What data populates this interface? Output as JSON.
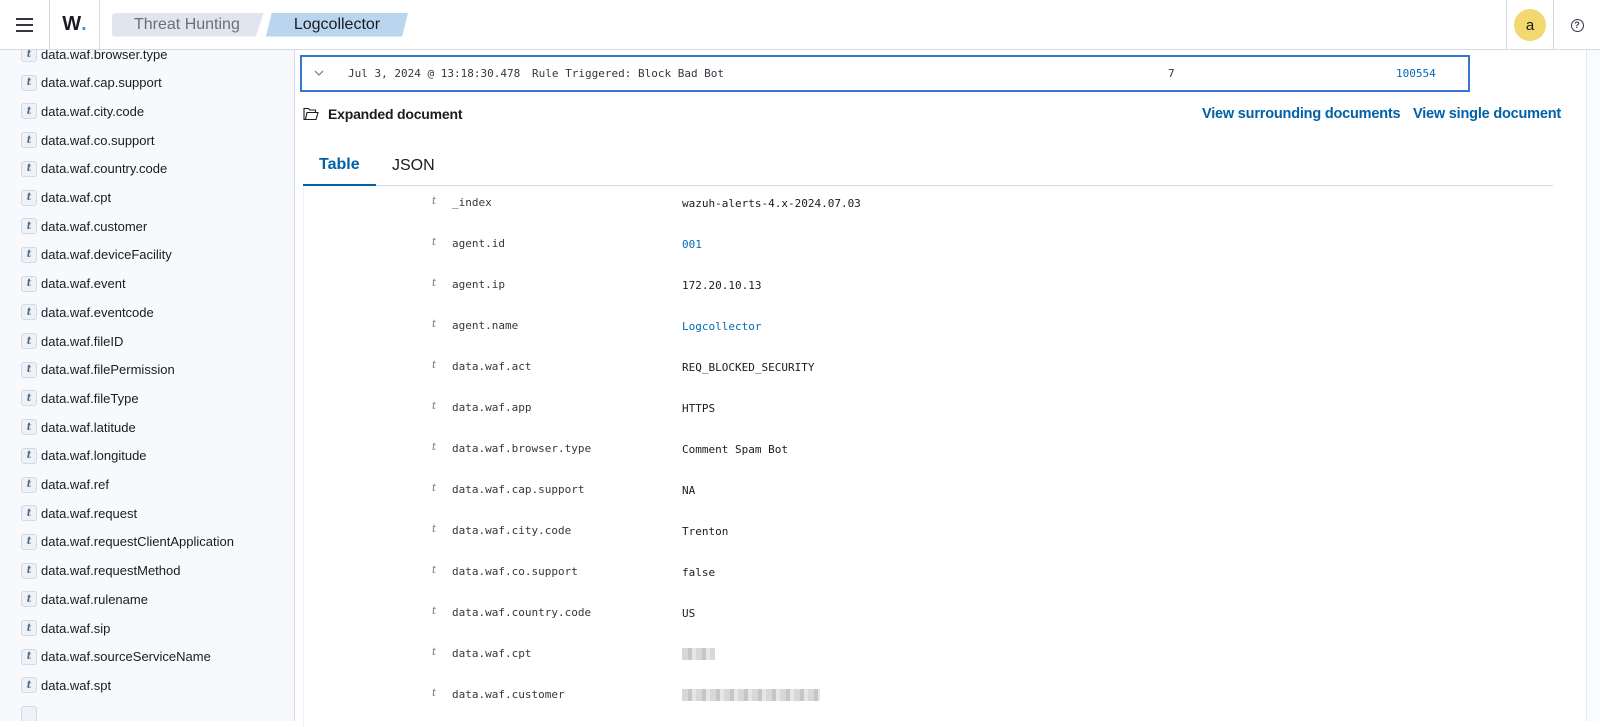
{
  "header": {
    "menu_icon": "hamburger-icon",
    "logo_text": "W",
    "logo_dot": ".",
    "breadcrumbs": [
      {
        "label": "Threat Hunting"
      },
      {
        "label": "Logcollector"
      }
    ],
    "avatar_initial": "a",
    "help_icon": "?"
  },
  "sidebar": {
    "field_type": "t",
    "items": [
      {
        "label": "data.waf.browser.type"
      },
      {
        "label": "data.waf.cap.support"
      },
      {
        "label": "data.waf.city.code"
      },
      {
        "label": "data.waf.co.support"
      },
      {
        "label": "data.waf.country.code"
      },
      {
        "label": "data.waf.cpt"
      },
      {
        "label": "data.waf.customer"
      },
      {
        "label": "data.waf.deviceFacility"
      },
      {
        "label": "data.waf.event"
      },
      {
        "label": "data.waf.eventcode"
      },
      {
        "label": "data.waf.fileID"
      },
      {
        "label": "data.waf.filePermission"
      },
      {
        "label": "data.waf.fileType"
      },
      {
        "label": "data.waf.latitude"
      },
      {
        "label": "data.waf.longitude"
      },
      {
        "label": "data.waf.ref"
      },
      {
        "label": "data.waf.request"
      },
      {
        "label": "data.waf.requestClientApplication"
      },
      {
        "label": "data.waf.requestMethod"
      },
      {
        "label": "data.waf.rulename"
      },
      {
        "label": "data.waf.sip"
      },
      {
        "label": "data.waf.sourceServiceName"
      },
      {
        "label": "data.waf.spt"
      }
    ]
  },
  "event_row": {
    "timestamp": "Jul 3, 2024 @ 13:18:30.478",
    "description": "Rule Triggered: Block Bad Bot",
    "rule_level": "7",
    "rule_id": "100554"
  },
  "expanded": {
    "title": "Expanded document",
    "view_surrounding": "View surrounding documents",
    "view_single": "View single document",
    "tabs": [
      {
        "label": "Table",
        "active": true
      },
      {
        "label": "JSON",
        "active": false
      }
    ],
    "type_glyph": "t",
    "fields": [
      {
        "name": "_index",
        "value": "wazuh-alerts-4.x-2024.07.03",
        "link": false
      },
      {
        "name": "agent.id",
        "value": "001",
        "link": true
      },
      {
        "name": "agent.ip",
        "value": "172.20.10.13",
        "link": false
      },
      {
        "name": "agent.name",
        "value": "Logcollector",
        "link": true
      },
      {
        "name": "data.waf.act",
        "value": "REQ_BLOCKED_SECURITY",
        "link": false
      },
      {
        "name": "data.waf.app",
        "value": "HTTPS",
        "link": false
      },
      {
        "name": "data.waf.browser.type",
        "value": "Comment Spam Bot",
        "link": false
      },
      {
        "name": "data.waf.cap.support",
        "value": "NA",
        "link": false
      },
      {
        "name": "data.waf.city.code",
        "value": "Trenton",
        "link": false
      },
      {
        "name": "data.waf.co.support",
        "value": "false",
        "link": false
      },
      {
        "name": "data.waf.country.code",
        "value": "US",
        "link": false
      },
      {
        "name": "data.waf.cpt",
        "value": "[redacted]",
        "redacted": true,
        "link": false
      },
      {
        "name": "data.waf.customer",
        "value": "[redacted]",
        "redacted": true,
        "link": false
      }
    ]
  },
  "colors": {
    "accent": "#0061a6",
    "link": "#006bb8",
    "selected_row_border": "#3477d1",
    "breadcrumb_active": "#b9d6ee",
    "breadcrumb_inactive": "#e0e5ee",
    "avatar": "#f1d86f"
  }
}
